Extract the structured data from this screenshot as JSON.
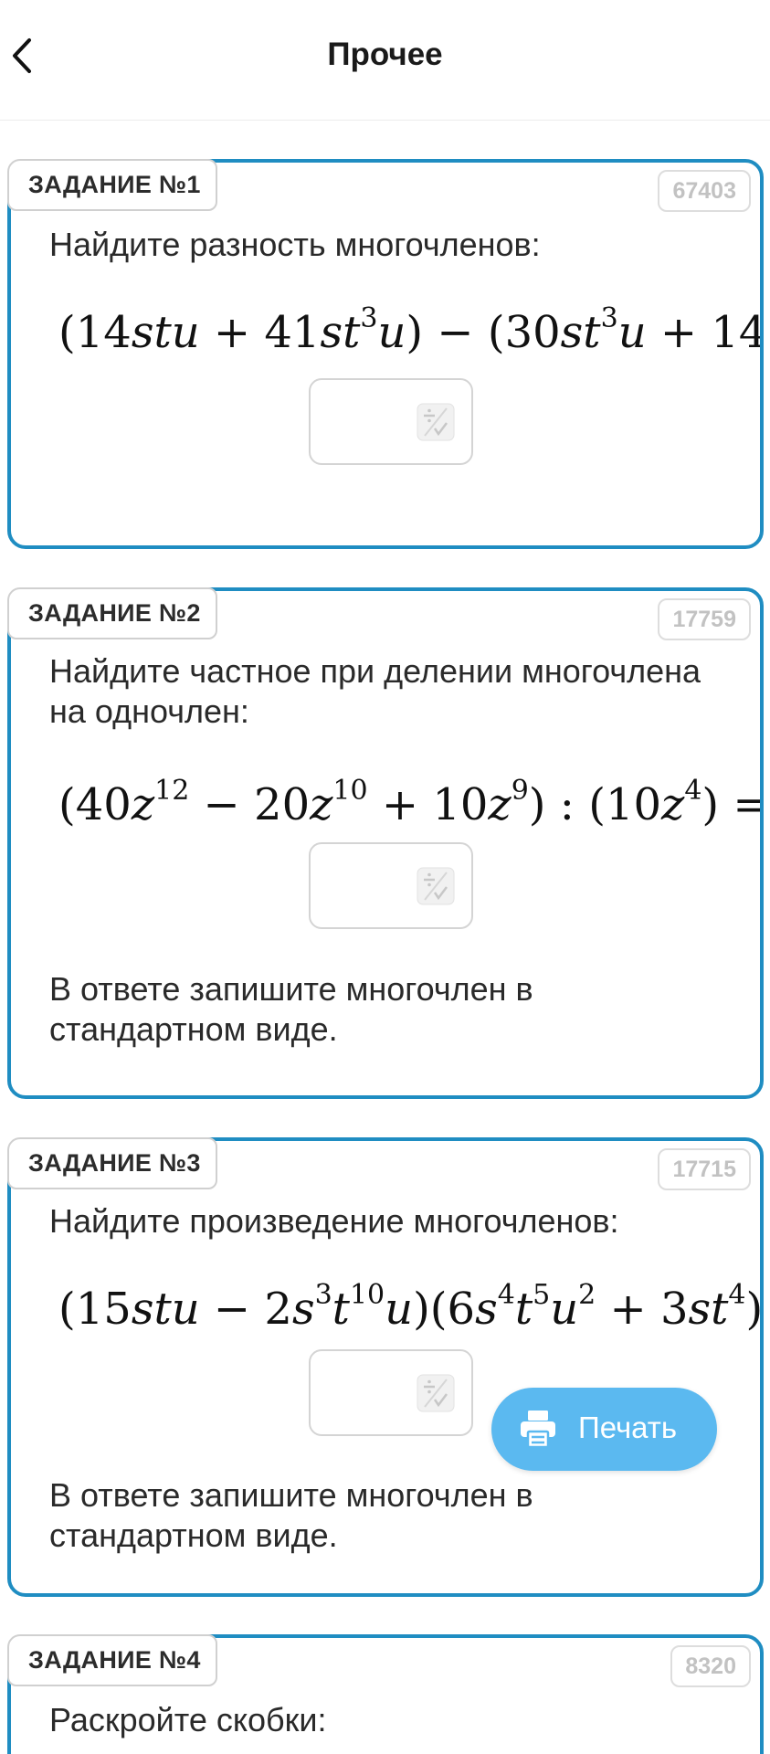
{
  "header": {
    "title": "Прочее",
    "back_icon": "chevron-left-icon"
  },
  "tasks": [
    {
      "label": "ЗАДАНИЕ №1",
      "id": "67403",
      "prompt": "Найдите разность многочленов:",
      "note": ""
    },
    {
      "label": "ЗАДАНИЕ №2",
      "id": "17759",
      "prompt": "Найдите частное при делении многочлена на одночлен:",
      "note": "В ответе запишите многочлен в стандартном виде."
    },
    {
      "label": "ЗАДАНИЕ №3",
      "id": "17715",
      "prompt": "Найдите произведение многочленов:",
      "note": "В ответе запишите многочлен в стандартном виде."
    },
    {
      "label": "ЗАДАНИЕ №4",
      "id": "8320",
      "prompt": "Раскройте скобки:",
      "note": ""
    }
  ],
  "print_button": {
    "label": "Печать",
    "icon": "printer-icon"
  },
  "colors": {
    "card_border": "#1f8dc2",
    "print_button": "#5bb9f0"
  }
}
